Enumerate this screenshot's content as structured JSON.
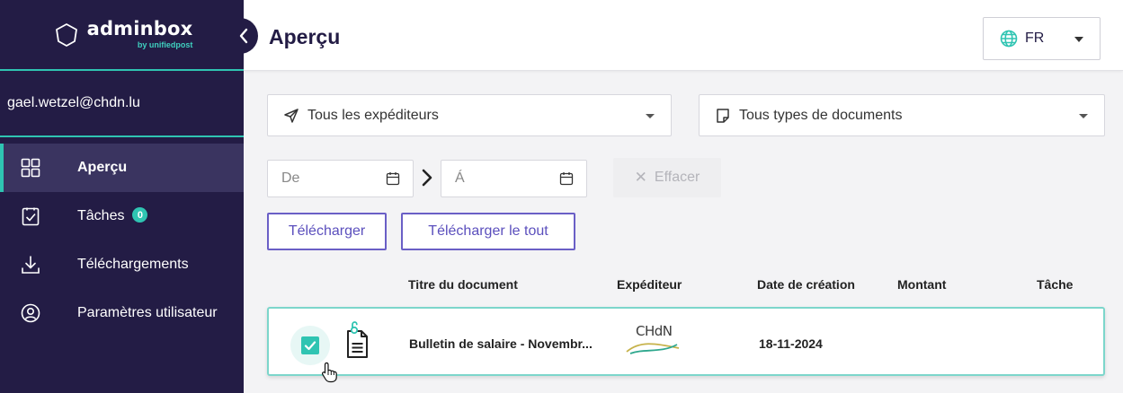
{
  "brand": {
    "name": "adminbox",
    "sub": "by unifiedpost"
  },
  "user": {
    "email": "gael.wetzel@chdn.lu"
  },
  "nav": {
    "items": [
      {
        "label": "Aperçu",
        "icon": "grid-icon",
        "active": true
      },
      {
        "label": "Tâches",
        "icon": "task-clipboard-icon",
        "badge": "0"
      },
      {
        "label": "Téléchargements",
        "icon": "download-icon"
      },
      {
        "label": "Paramètres utilisateur",
        "icon": "user-circle-icon"
      }
    ]
  },
  "header": {
    "title": "Aperçu",
    "language": "FR"
  },
  "filters": {
    "sender_select": "Tous les expéditeurs",
    "doctype_select": "Tous types de documents",
    "date_from_placeholder": "De",
    "date_to_placeholder": "Á",
    "clear_label": "Effacer"
  },
  "actions": {
    "download_label": "Télécharger",
    "download_all_label": "Télécharger le tout"
  },
  "table": {
    "columns": [
      "Titre du document",
      "Expéditeur",
      "Date de création",
      "Montant",
      "Tâche"
    ],
    "rows": [
      {
        "selected": true,
        "title": "Bulletin de salaire - Novembr...",
        "sender_logo": "CHdN",
        "date": "18-11-2024",
        "amount": "",
        "task": ""
      }
    ]
  },
  "colors": {
    "sidebar": "#231c45",
    "accent": "#2fc4b2",
    "button": "#5b4fbd"
  }
}
